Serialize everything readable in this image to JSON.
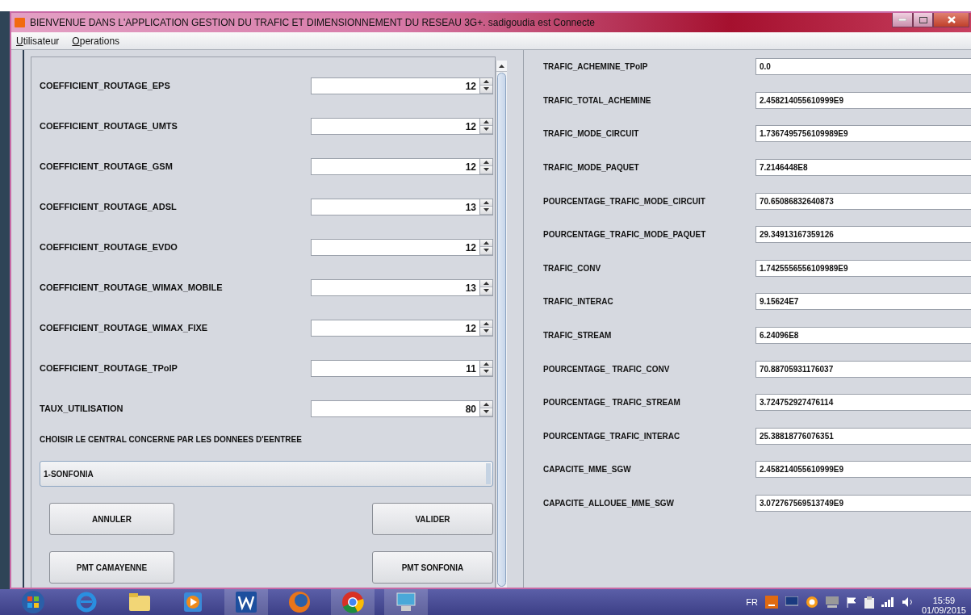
{
  "window": {
    "title": "BIENVENUE DANS L'APPLICATION GESTION DU TRAFIC ET DIMENSIONNEMENT DU RESEAU 3G+. sadigoudia est Connecte"
  },
  "menu": [
    {
      "label": "Utilisateur"
    },
    {
      "label": "Operations"
    }
  ],
  "coefficients": [
    {
      "label": "COEFFICIENT_ROUTAGE_EPS",
      "value": "12"
    },
    {
      "label": "COEFFICIENT_ROUTAGE_UMTS",
      "value": "12"
    },
    {
      "label": "COEFFICIENT_ROUTAGE_GSM",
      "value": "12"
    },
    {
      "label": "COEFFICIENT_ROUTAGE_ADSL",
      "value": "13"
    },
    {
      "label": "COEFFICIENT_ROUTAGE_EVDO",
      "value": "12"
    },
    {
      "label": "COEFFICIENT_ROUTAGE_WIMAX_MOBILE",
      "value": "13"
    },
    {
      "label": "COEFFICIENT_ROUTAGE_WIMAX_FIXE",
      "value": "12"
    },
    {
      "label": "COEFFICIENT_ROUTAGE_TPoIP",
      "value": "11"
    },
    {
      "label": "TAUX_UTILISATION",
      "value": "80"
    }
  ],
  "central": {
    "label": "CHOISIR LE CENTRAL CONCERNE PAR LES DONNEES D'EENTREE",
    "value": "1-SONFONIA"
  },
  "buttons": [
    {
      "label": "ANNULER"
    },
    {
      "label": "VALIDER"
    },
    {
      "label": "PMT CAMAYENNE"
    },
    {
      "label": "PMT SONFONIA"
    }
  ],
  "results": [
    {
      "label": "TRAFIC_ACHEMINE_TPoIP",
      "value": "0.0"
    },
    {
      "label": "TRAFIC_TOTAL_ACHEMINE",
      "value": "2.458214055610999E9"
    },
    {
      "label": "TRAFIC_MODE_CIRCUIT",
      "value": "1.7367495756109989E9"
    },
    {
      "label": "TRAFIC_MODE_PAQUET",
      "value": "7.2146448E8"
    },
    {
      "label": "POURCENTAGE_TRAFIC_MODE_CIRCUIT",
      "value": "70.65086832640873"
    },
    {
      "label": "POURCENTAGE_TRAFIC_MODE_PAQUET",
      "value": "29.34913167359126"
    },
    {
      "label": "TRAFIC_CONV",
      "value": "1.7425556556109989E9"
    },
    {
      "label": "TRAFIC_INTERAC",
      "value": "9.15624E7"
    },
    {
      "label": "TRAFIC_STREAM",
      "value": "6.24096E8"
    },
    {
      "label": "POURCENTAGE_ TRAFIC_CONV",
      "value": "70.88705931176037"
    },
    {
      "label": "POURCENTAGE_ TRAFIC_STREAM",
      "value": "3.724752927476114"
    },
    {
      "label": "POURCENTAGE_TRAFIC_INTERAC",
      "value": "25.38818776076351"
    },
    {
      "label": "CAPACITE_MME_SGW",
      "value": "2.458214055610999E9"
    },
    {
      "label": "CAPACITE_ALLOUEE_MME_SGW",
      "value": "3.072767569513749E9"
    }
  ],
  "taskbar": {
    "language": "FR",
    "time": "15:59",
    "date": "01/09/2015"
  }
}
